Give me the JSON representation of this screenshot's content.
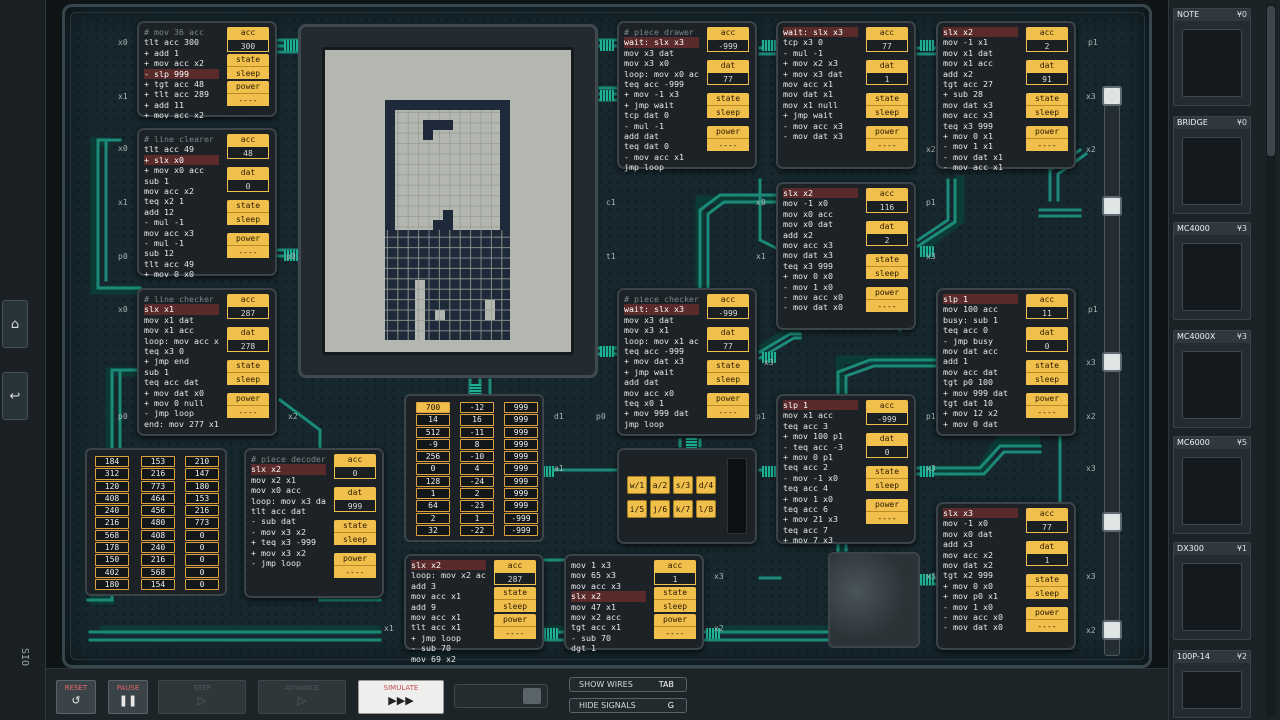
{
  "nav": {
    "home_icon": "home-icon",
    "undo_icon": "undo-icon",
    "logo": "SIO"
  },
  "chips": {
    "chipA": {
      "lines": [
        "# mov 36 acc",
        "tlt acc 300",
        "+ add 1",
        "+ mov acc x2",
        "- slp 999",
        "+ tgt acc 48",
        "+ tlt acc 289",
        "+ add 11",
        "+ mov acc x2"
      ],
      "hl": 4,
      "acc": "300",
      "state": "sleep",
      "power": "----"
    },
    "chipB": {
      "lines": [
        "# line clearer",
        "tlt acc 49",
        "+ slx x0",
        "+ mov x0 acc",
        "sub 1",
        "mov acc x2",
        "teq x2 1",
        "add 12",
        "- mul -1",
        "mov acc x3",
        "- mul -1",
        "sub 12",
        "tlt acc 49",
        "+ mov 0 x0"
      ],
      "hl": 2,
      "acc": "48",
      "dat": "0",
      "state": "sleep",
      "power": "----"
    },
    "chipC": {
      "lines": [
        "# line checker",
        "slx x1",
        "mov x1 dat",
        "mov x1 acc",
        "loop: mov acc x3",
        "teq x3 0",
        "+ jmp end",
        "sub 1",
        "teq acc dat",
        "+ mov dat x0",
        "+ mov 0 null",
        "- jmp loop",
        "end: mov 277 x1"
      ],
      "hl": 1,
      "acc": "287",
      "dat": "278",
      "state": "sleep",
      "power": "----"
    },
    "chipD": {
      "lines": [
        "# piece decoder",
        "slx x2",
        "mov x2 x1",
        "mov x0 acc",
        "loop: mov x3 dat",
        "tlt acc dat",
        "- sub dat",
        "- mov x3 x2",
        "+ teq x3 -999",
        "+ mov x3 x2",
        "- jmp loop"
      ],
      "hl": 1,
      "acc": "0",
      "dat": "999",
      "state": "sleep",
      "power": "----"
    },
    "chipE": {
      "lines": [
        "# piece drawer",
        "wait: slx x3",
        "mov x3 dat",
        "mov x3 x0",
        "loop: mov x0 acc",
        "teq acc -999",
        "+ mov -1 x3",
        "+ jmp wait",
        "tcp dat 0",
        "- mul -1",
        "add dat",
        "teq dat 0",
        "- mov acc x1",
        "jmp loop"
      ],
      "hl": 1,
      "acc": "-999",
      "dat": "77",
      "state": "sleep",
      "power": "----"
    },
    "chipF": {
      "lines": [
        "wait: slx x3",
        "tcp x3 0",
        "- mul -1",
        "+ mov x2 x3",
        "+ mov x3 dat",
        "mov acc x1",
        "mov dat x1",
        "mov x1 null",
        "+ jmp wait",
        "- mov acc x3",
        "- mov dat x3"
      ],
      "hl": 0,
      "acc": "77",
      "dat": "1",
      "state": "sleep",
      "power": "----"
    },
    "chipG": {
      "lines": [
        "slx x2",
        "mov -1 x1",
        "mov x1 dat",
        "mov x1 acc",
        "add x2",
        "tgt acc 27",
        "+ sub 28",
        "mov dat x3",
        "mov acc x3",
        "teq x3 999",
        "+ mov 0 x1",
        "- mov 1 x1",
        "- mov dat x1",
        "- mov acc x1"
      ],
      "hl": 0,
      "acc": "2",
      "dat": "91",
      "state": "sleep",
      "power": "----"
    },
    "chipH": {
      "lines": [
        "slx x2",
        "mov -1 x0",
        "mov x0 acc",
        "mov x0 dat",
        "add x2",
        "mov acc x3",
        "mov dat x3",
        "teq x3 999",
        "+ mov 0 x0",
        "- mov 1 x0",
        "- mov acc x0",
        "- mov dat x0"
      ],
      "hl": 0,
      "acc": "116",
      "dat": "2",
      "state": "sleep",
      "power": "----"
    },
    "chipI": {
      "lines": [
        "# piece checker",
        "wait: slx x3",
        "mov x3 dat",
        "mov x3 x1",
        "loop: mov x1 acc",
        "teq acc -999",
        "+ mov dat x3",
        "+ jmp wait",
        "add dat",
        "mov acc x0",
        "teq x0 1",
        "+ mov 999 dat",
        "jmp loop"
      ],
      "hl": 1,
      "acc": "-999",
      "dat": "77",
      "state": "sleep",
      "power": "----"
    },
    "chipJ": {
      "lines": [
        "slp 1",
        "mov 100 acc",
        "busy: sub 1",
        "teq acc 0",
        "- jmp busy",
        "mov dat acc",
        "add 1",
        "mov acc dat",
        "tgt p0 100",
        "+ mov 999 dat",
        "tgt dat 10",
        "+ mov 12 x2",
        "+ mov 0 dat"
      ],
      "hl": 0,
      "acc": "11",
      "dat": "0",
      "state": "sleep",
      "power": "----"
    },
    "chipK": {
      "lines": [
        "slp 1",
        "mov x1 acc",
        "teq acc 3",
        "+ mov 100 p1",
        "- teq acc -3",
        "+ mov 0 p1",
        "teq acc 2",
        "- mov -1 x0",
        "teq acc 4",
        "+ mov 1 x0",
        "teq acc 6",
        "+ mov 21 x3",
        "teq acc 7",
        "+ mov 7 x3"
      ],
      "hl": 0,
      "acc": "-999",
      "dat": "0",
      "state": "sleep",
      "power": "----"
    },
    "chipL": {
      "lines": [
        "slx x3",
        "mov -1 x0",
        "mov x0 dat",
        "add x3",
        "mov acc x2",
        "mov dat x2",
        "tgt x2 999",
        "+ mov 0 x0",
        "+ mov p0 x1",
        "- mov 1 x0",
        "- mov acc x0",
        "- mov dat x0"
      ],
      "hl": 0,
      "acc": "77",
      "dat": "1",
      "state": "sleep",
      "power": "----"
    },
    "chipM": {
      "lines": [
        "slx x2",
        "loop: mov x2 acc",
        "add 3",
        "mov acc x1",
        "add 9",
        "mov acc x1",
        "tlt acc x1",
        "+ jmp loop",
        "- sub 70",
        "mov 69 x2"
      ],
      "hl": 0,
      "acc": "287",
      "state": "sleep",
      "power": "----"
    },
    "chipN": {
      "lines": [
        "mov 1 x3",
        "mov 65 x3",
        "mov acc x3",
        "slx x2",
        "mov 47 x1",
        "mov x2 acc",
        "tgt acc x1",
        "- sub 70",
        "dgt 1"
      ],
      "hl": 3,
      "acc": "1",
      "state": "sleep",
      "power": "----"
    }
  },
  "reg_labels": {
    "acc": "acc",
    "dat": "dat",
    "state": "state",
    "power": "power"
  },
  "rom1": {
    "cols": [
      [
        "184",
        "312",
        "120",
        "408",
        "240",
        "216",
        "568",
        "178",
        "150",
        "402",
        "180"
      ],
      [
        "153",
        "216",
        "773",
        "464",
        "456",
        "480",
        "408",
        "240",
        "216",
        "568",
        "154"
      ],
      [
        "210",
        "147",
        "180",
        "153",
        "216",
        "773",
        "0",
        "0",
        "0",
        "0",
        "0"
      ]
    ]
  },
  "rom2": {
    "cols": [
      [
        "700",
        "14",
        "512",
        "-9",
        "256",
        "0",
        "128",
        "1",
        "64",
        "2",
        "32"
      ],
      [
        "-12",
        "16",
        "-11",
        "8",
        "-10",
        "4",
        "-24",
        "2",
        "-23",
        "1",
        "-22"
      ],
      [
        "999",
        "999",
        "999",
        "999",
        "999",
        "999",
        "999",
        "999",
        "999",
        "-999",
        "-999"
      ]
    ],
    "sel": 0
  },
  "keys": [
    "w/1",
    "a/2",
    "s/3",
    "d/4",
    "i/5",
    "j/6",
    "k/7",
    "l/8"
  ],
  "pins": [
    "x0",
    "x1",
    "x0",
    "x1",
    "p0",
    "x0",
    "p0",
    "x2",
    "x1",
    "x2",
    "x3",
    "x3",
    "x3",
    "x3",
    "x3",
    "x0",
    "x1",
    "p1",
    "p1",
    "p1",
    "x3",
    "x3",
    "x3",
    "x2",
    "x2",
    "x2",
    "p1",
    "p1",
    "x2",
    "x3",
    "c1",
    "t1",
    "d1",
    "a1",
    "p0",
    "p0"
  ],
  "controls": {
    "reset": "RESET",
    "pause": "PAUSE",
    "step": "STEP",
    "advance": "ADVANCE",
    "simulate": "SIMULATE"
  },
  "toggles": {
    "show_wires": "SHOW WIRES",
    "show_wires_key": "TAB",
    "hide_signals": "HIDE SIGNALS",
    "hide_signals_key": "G"
  },
  "sidebar": [
    {
      "name": "NOTE",
      "price": "¥0"
    },
    {
      "name": "BRIDGE",
      "price": "¥0"
    },
    {
      "name": "MC4000",
      "price": "¥3"
    },
    {
      "name": "MC4000X",
      "price": "¥3"
    },
    {
      "name": "MC6000",
      "price": "¥5"
    },
    {
      "name": "DX300",
      "price": "¥1"
    },
    {
      "name": "100P-14",
      "price": "¥2"
    }
  ],
  "colors": {
    "accent": "#f1bf4c",
    "wire": "#1b8a78",
    "highlight": "#5b2a2a"
  }
}
